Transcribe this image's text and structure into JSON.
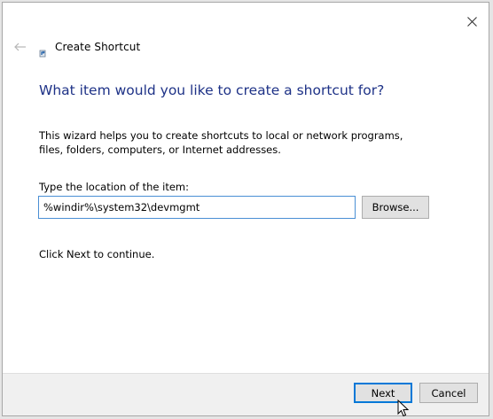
{
  "window": {
    "title": "Create Shortcut",
    "close_icon": "close-icon",
    "back_icon": "back-arrow-icon",
    "title_icon": "shortcut-icon"
  },
  "main": {
    "heading": "What item would you like to create a shortcut for?",
    "description": "This wizard helps you to create shortcuts to local or network programs, files, folders, computers, or Internet addresses.",
    "location_label": "Type the location of the item:",
    "location_value": "%windir%\\system32\\devmgmt",
    "browse_label": "Browse...",
    "continue_text": "Click Next to continue."
  },
  "footer": {
    "next_label": "Next",
    "cancel_label": "Cancel"
  },
  "colors": {
    "heading": "#1e3287",
    "accent": "#0078d7",
    "input_border": "#4a8fd4"
  }
}
